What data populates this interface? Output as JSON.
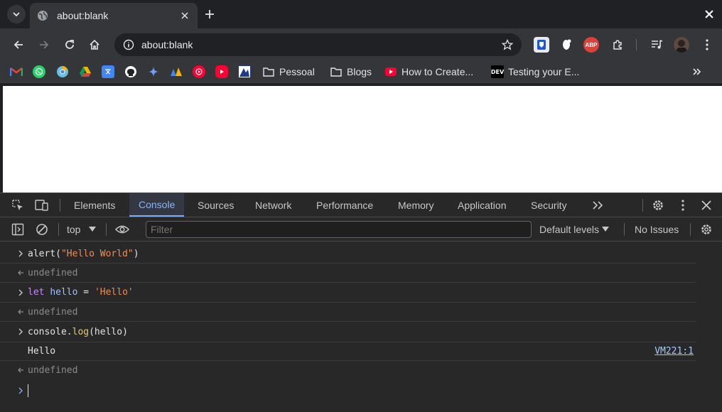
{
  "browser": {
    "tab_title": "about:blank",
    "url": "about:blank"
  },
  "bookmarks": {
    "folder1": "Pessoal",
    "folder2": "Blogs",
    "link1": "How to Create...",
    "link2": "Testing your E...",
    "dev_badge": "DEV",
    "abp_badge": "ABP"
  },
  "devtools": {
    "tabs": [
      "Elements",
      "Console",
      "Sources",
      "Network",
      "Performance",
      "Memory",
      "Application",
      "Security"
    ],
    "active_tab": "Console",
    "context": "top",
    "filter_placeholder": "Filter",
    "levels": "Default levels",
    "issues": "No Issues"
  },
  "console": {
    "entries": [
      {
        "kind": "input",
        "parts": [
          "alert(",
          "\"Hello World\"",
          ")"
        ]
      },
      {
        "kind": "result",
        "text": "undefined"
      },
      {
        "kind": "input",
        "parts": [
          "let",
          " ",
          "hello",
          " = ",
          "'Hello'"
        ]
      },
      {
        "kind": "result",
        "text": "undefined"
      },
      {
        "kind": "input",
        "parts": [
          "console",
          ".",
          "log",
          "(hello)"
        ]
      },
      {
        "kind": "log",
        "text": "Hello",
        "source": "VM221:1"
      },
      {
        "kind": "result",
        "text": "undefined"
      }
    ]
  },
  "colors": {
    "string": "#f28b54",
    "keyword": "#c58af9",
    "variable": "#9cc0f8",
    "function": "#e6c76e",
    "accent": "#8ab4f8"
  }
}
